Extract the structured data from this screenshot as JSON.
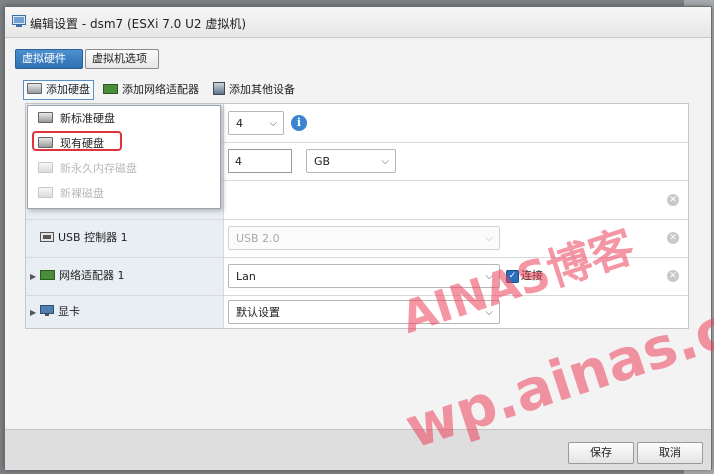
{
  "window": {
    "title": "编辑设置 - dsm7 (ESXi 7.0 U2 虚拟机)"
  },
  "tabs": [
    {
      "label": "虚拟硬件",
      "active": true
    },
    {
      "label": "虚拟机选项",
      "active": false
    }
  ],
  "toolbar": {
    "add_disk": "添加硬盘",
    "add_network": "添加网络适配器",
    "add_other": "添加其他设备"
  },
  "add_disk_menu": {
    "items": [
      {
        "label": "新标准硬盘",
        "enabled": true
      },
      {
        "label": "现有硬盘",
        "enabled": true,
        "highlighted": true
      },
      {
        "label": "新永久内存磁盘",
        "enabled": false
      },
      {
        "label": "新裸磁盘",
        "enabled": false
      }
    ]
  },
  "hardware": {
    "cpu": {
      "value": "4"
    },
    "memory": {
      "value": "4",
      "unit": "GB"
    },
    "usb": {
      "label": "USB 控制器 1",
      "value": "USB 2.0"
    },
    "network": {
      "label": "网络适配器 1",
      "value": "Lan",
      "connect_label": "连接",
      "connected": true
    },
    "display": {
      "label": "显卡",
      "value": "默认设置"
    }
  },
  "footer": {
    "save": "保存",
    "cancel": "取消"
  },
  "watermark": {
    "line1": "AINAS博客",
    "line2": "wp.ainas.cc"
  },
  "colors": {
    "accent": "#2e6fb4",
    "highlight_box": "#e0323a",
    "watermark": "#ec405a"
  },
  "icons": [
    "window-icon",
    "disk-icon",
    "network-icon",
    "device-icon",
    "info-icon",
    "remove-icon",
    "usb-icon",
    "monitor-icon",
    "cursor-icon"
  ]
}
